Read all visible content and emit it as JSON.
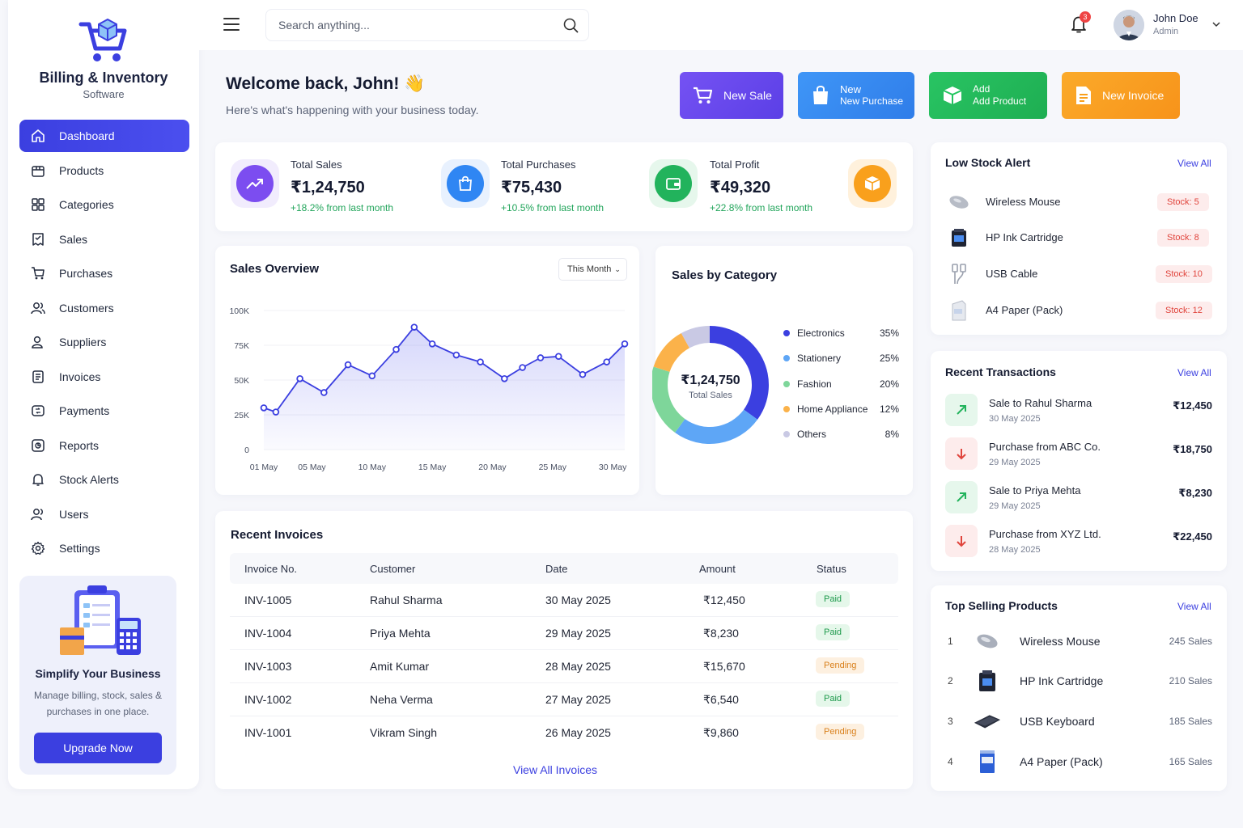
{
  "brand": {
    "title": "Billing & Inventory",
    "subtitle": "Software"
  },
  "sidebar": {
    "items": [
      {
        "label": "Dashboard",
        "icon": "home-icon",
        "active": true
      },
      {
        "label": "Products",
        "icon": "box-icon"
      },
      {
        "label": "Categories",
        "icon": "grid-icon"
      },
      {
        "label": "Sales",
        "icon": "receipt-icon"
      },
      {
        "label": "Purchases",
        "icon": "cart-icon"
      },
      {
        "label": "Customers",
        "icon": "users-icon"
      },
      {
        "label": "Suppliers",
        "icon": "user-group-icon"
      },
      {
        "label": "Invoices",
        "icon": "document-icon"
      },
      {
        "label": "Payments",
        "icon": "wallet-icon"
      },
      {
        "label": "Reports",
        "icon": "report-icon"
      },
      {
        "label": "Stock Alerts",
        "icon": "bell-icon"
      },
      {
        "label": "Users",
        "icon": "user-icon"
      },
      {
        "label": "Settings",
        "icon": "gear-icon"
      }
    ],
    "promo": {
      "title": "Simplify Your Business",
      "text": "Manage billing, stock, sales & purchases in one place.",
      "button": "Upgrade Now"
    }
  },
  "topbar": {
    "search_placeholder": "Search anything...",
    "notifications": "3",
    "user_name": "John Doe",
    "user_role": "Admin"
  },
  "welcome": {
    "title": "Welcome back, John! 👋",
    "subtitle": "Here's what's happening with your business today."
  },
  "quick_actions": [
    {
      "label": "New Sale",
      "color": "#6c4df2"
    },
    {
      "label": "New",
      "label2": "New Purchase",
      "color": "#3b8cf5"
    },
    {
      "label": "Add",
      "label2": "Add Product",
      "color": "#22c55e"
    },
    {
      "label": "New Invoice",
      "color": "#f9a01c"
    }
  ],
  "stats": [
    {
      "label": "Total Sales",
      "value": "₹1,24,750",
      "change": "+18.2% from last month",
      "color": "#7c4df0"
    },
    {
      "label": "Total Purchases",
      "value": "₹75,430",
      "change": "+10.5% from last month",
      "color": "#2f86f3"
    },
    {
      "label": "Total Profit",
      "value": "₹49,320",
      "change": "+22.8% from last month",
      "color": "#22b35c"
    }
  ],
  "sales_overview": {
    "title": "Sales Overview",
    "period": "This Month"
  },
  "chart_data": [
    {
      "type": "area",
      "title": "Sales Overview",
      "x_ticks": [
        "01 May",
        "05 May",
        "10 May",
        "15 May",
        "20 May",
        "25 May",
        "30 May"
      ],
      "y_ticks": [
        "0",
        "25K",
        "50K",
        "75K",
        "100K"
      ],
      "ylim": [
        0,
        100000
      ],
      "x": [
        1,
        2,
        4,
        6,
        8,
        10,
        12,
        13.5,
        15,
        17,
        19,
        21,
        22.5,
        24,
        25.5,
        27.5,
        29.5,
        31
      ],
      "values": [
        30000,
        27000,
        51000,
        41000,
        61000,
        53000,
        72000,
        88000,
        76000,
        68000,
        63000,
        51000,
        59000,
        66000,
        67000,
        54000,
        63000,
        76000
      ],
      "color": "#3b3fe0"
    },
    {
      "type": "pie",
      "title": "Sales by Category",
      "center_value": "₹1,24,750",
      "center_label": "Total Sales",
      "slices": [
        {
          "name": "Electronics",
          "value": 35,
          "label": "35%",
          "color": "#3b3fe0"
        },
        {
          "name": "Stationery",
          "value": 25,
          "label": "25%",
          "color": "#5ea6f6"
        },
        {
          "name": "Fashion",
          "value": 20,
          "label": "20%",
          "color": "#7ed69a"
        },
        {
          "name": "Home Appliance",
          "value": 12,
          "label": "12%",
          "color": "#fbb24a"
        },
        {
          "name": "Others",
          "value": 8,
          "label": "8%",
          "color": "#c9c9e4"
        }
      ]
    }
  ],
  "low_stock": {
    "title": "Low Stock Alert",
    "view_all": "View All",
    "items": [
      {
        "name": "Wireless Mouse",
        "stock": "Stock: 5"
      },
      {
        "name": "HP Ink Cartridge",
        "stock": "Stock: 8"
      },
      {
        "name": "USB Cable",
        "stock": "Stock: 10"
      },
      {
        "name": "A4 Paper (Pack)",
        "stock": "Stock: 12"
      }
    ]
  },
  "transactions": {
    "title": "Recent Transactions",
    "view_all": "View All",
    "items": [
      {
        "name": "Sale to Rahul Sharma",
        "date": "30 May 2025",
        "amount": "₹12,450",
        "kind": "sale"
      },
      {
        "name": "Purchase from ABC Co.",
        "date": "29 May 2025",
        "amount": "₹18,750",
        "kind": "purchase"
      },
      {
        "name": "Sale to Priya Mehta",
        "date": "29 May 2025",
        "amount": "₹8,230",
        "kind": "sale"
      },
      {
        "name": "Purchase from XYZ Ltd.",
        "date": "28 May 2025",
        "amount": "₹22,450",
        "kind": "purchase"
      }
    ]
  },
  "top_products": {
    "title": "Top Selling Products",
    "view_all": "View All",
    "items": [
      {
        "rank": "1",
        "name": "Wireless Mouse",
        "sales": "245 Sales"
      },
      {
        "rank": "2",
        "name": "HP Ink Cartridge",
        "sales": "210 Sales"
      },
      {
        "rank": "3",
        "name": "USB Keyboard",
        "sales": "185 Sales"
      },
      {
        "rank": "4",
        "name": "A4 Paper (Pack)",
        "sales": "165 Sales"
      }
    ]
  },
  "invoices": {
    "title": "Recent Invoices",
    "columns": [
      "Invoice No.",
      "Customer",
      "Date",
      "Amount",
      "Status"
    ],
    "rows": [
      [
        "INV-1005",
        "Rahul Sharma",
        "30 May 2025",
        "₹12,450",
        "Paid"
      ],
      [
        "INV-1004",
        "Priya Mehta",
        "29 May 2025",
        "₹8,230",
        "Paid"
      ],
      [
        "INV-1003",
        "Amit Kumar",
        "28 May 2025",
        "₹15,670",
        "Pending"
      ],
      [
        "INV-1002",
        "Neha Verma",
        "27 May 2025",
        "₹6,540",
        "Paid"
      ],
      [
        "INV-1001",
        "Vikram Singh",
        "26 May 2025",
        "₹9,860",
        "Pending"
      ]
    ],
    "view_all": "View All Invoices"
  }
}
